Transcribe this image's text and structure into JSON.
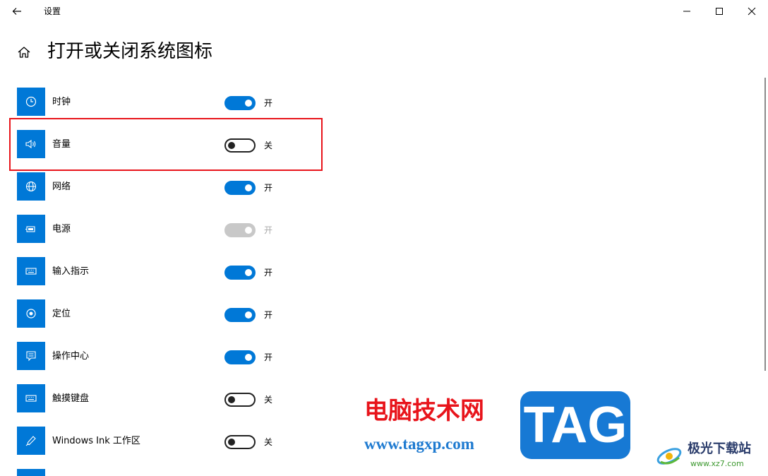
{
  "app": {
    "title": "设置"
  },
  "page": {
    "title": "打开或关闭系统图标"
  },
  "settings": [
    {
      "icon": "clock-icon",
      "label": "时钟",
      "state": "开"
    },
    {
      "icon": "volume-icon",
      "label": "音量",
      "state": "关"
    },
    {
      "icon": "globe-icon",
      "label": "网络",
      "state": "开"
    },
    {
      "icon": "battery-icon",
      "label": "电源",
      "state": "开"
    },
    {
      "icon": "keyboard-icon",
      "label": "输入指示",
      "state": "开"
    },
    {
      "icon": "location-icon",
      "label": "定位",
      "state": "开"
    },
    {
      "icon": "action-center-icon",
      "label": "操作中心",
      "state": "开"
    },
    {
      "icon": "keyboard-icon",
      "label": "触摸键盘",
      "state": "关"
    },
    {
      "icon": "pen-icon",
      "label": "Windows Ink 工作区",
      "state": "关"
    }
  ],
  "watermark": {
    "site_cn": "电脑技术网",
    "site_url": "www.tagxp.com",
    "tag": "TAG",
    "brand": "极光下载站",
    "brand_url": "www.xz7.com"
  },
  "colors": {
    "accent": "#0078d7",
    "highlight": "#e8141b"
  }
}
